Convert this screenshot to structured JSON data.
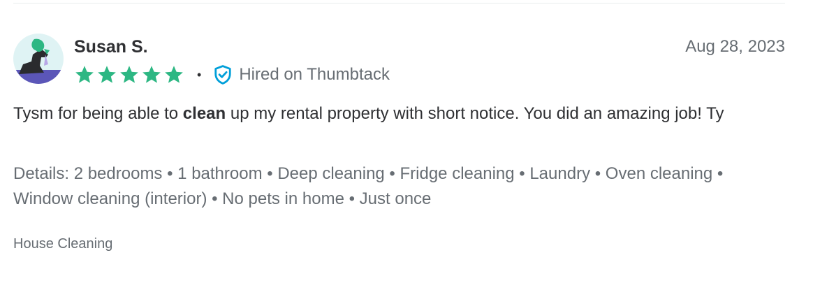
{
  "reviewer": {
    "name": "Susan S.",
    "avatar_icon": "person-silhouette-avatar"
  },
  "review_date": "Aug 28, 2023",
  "rating": {
    "stars": 5,
    "max": 5,
    "star_color": "#2db783",
    "icon": "star-icon"
  },
  "separator": "•",
  "verification": {
    "icon": "shield-check-icon",
    "icon_color": "#009fd9",
    "label": "Hired on Thumbtack"
  },
  "review": {
    "text_before": "Tysm for being able to ",
    "highlight": "clean",
    "text_after": " up my rental property with short notice. You did an amazing job! Ty"
  },
  "details": {
    "text": "Details: 2 bedrooms • 1 bathroom • Deep cleaning • Fridge cleaning • Laundry • Oven cleaning • Window cleaning (interior) • No pets in home • Just once"
  },
  "category": "House Cleaning"
}
